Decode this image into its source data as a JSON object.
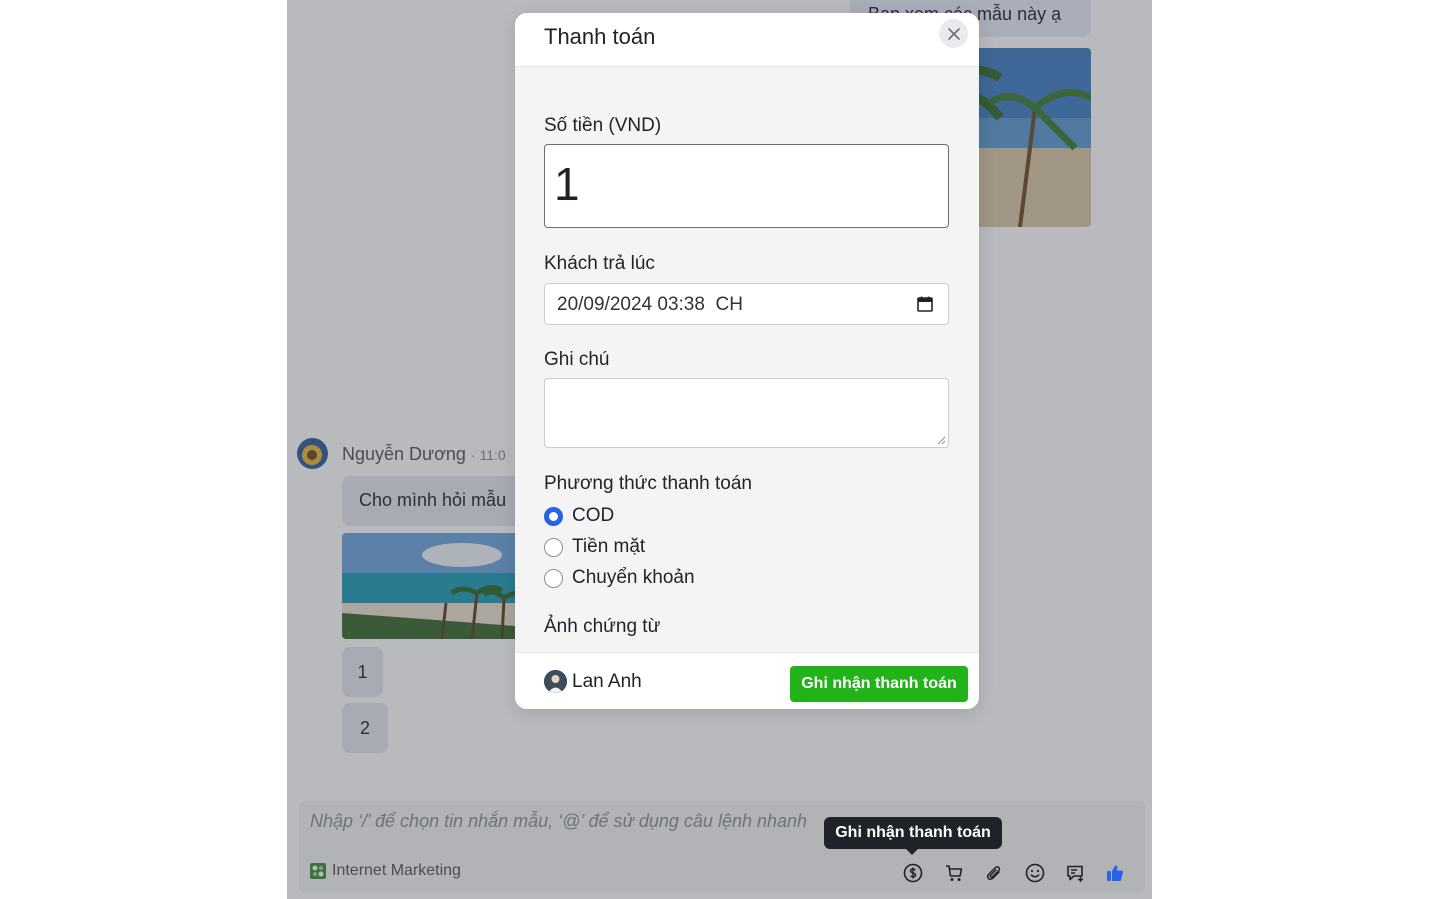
{
  "chat": {
    "outgoing_text": "Bạn xem các mẫu này ạ",
    "sender_name": "Nguyễn Dương",
    "sender_time": "· 11:0",
    "incoming_text": "Cho mình hỏi mẫu",
    "bubble_1": "1",
    "bubble_2": "2"
  },
  "composer": {
    "placeholder": "Nhập ‘/’ để chọn tin nhắn mẫu, ‘@’ để sử dụng câu lệnh nhanh",
    "source_label": "Internet Marketing",
    "tooltip": "Ghi nhận thanh toán",
    "icons": [
      "dollar-icon",
      "cart-icon",
      "paperclip-icon",
      "smile-icon",
      "message-plus-icon",
      "thumbs-up-icon"
    ]
  },
  "modal": {
    "title": "Thanh toán",
    "amount_label": "Số tiền (VND)",
    "amount_value": "1",
    "paid_at_label": "Khách trả lúc",
    "paid_at_value": "20/09/2024 03:38  CH",
    "note_label": "Ghi chú",
    "note_value": "",
    "method_label": "Phương thức thanh toán",
    "methods": [
      {
        "label": "COD",
        "checked": true
      },
      {
        "label": "Tiền mặt",
        "checked": false
      },
      {
        "label": "Chuyển khoản",
        "checked": false
      }
    ],
    "proof_label": "Ảnh chứng từ",
    "user_name": "Lan Anh",
    "submit_label": "Ghi nhận thanh toán"
  },
  "colors": {
    "primary": "#2563eb",
    "success": "#22b31a",
    "tooltip_bg": "#1f2329",
    "like": "#2563eb"
  }
}
